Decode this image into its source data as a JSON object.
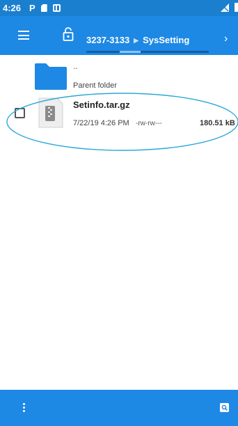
{
  "status_bar": {
    "time": "4:26",
    "p_icon": "P",
    "icons": [
      "p-icon",
      "sim-card-icon",
      "sd-card-icon",
      "no-signal-icon",
      "battery-icon"
    ]
  },
  "toolbar": {
    "menu_icon": "hamburger-menu-icon",
    "lock_icon": "lock-icon",
    "breadcrumb": [
      "3237-3133",
      "SysSetting"
    ],
    "breadcrumb_separator": "▶",
    "next_icon": "›"
  },
  "parent_folder": {
    "dots": "..",
    "label": "Parent folder"
  },
  "file": {
    "name": "Setinfo.tar.gz",
    "date": "7/22/19 4:26 PM",
    "permissions": "-rw-rw---",
    "size": "180.51 kB"
  },
  "bottom_bar": {
    "more_icon": "more-vert-icon",
    "search_icon": "search-icon"
  },
  "colors": {
    "status_bar": "#1b7fd0",
    "toolbar": "#1e88e5",
    "folder": "#1e88e5",
    "annotation": "#2aa8d8"
  }
}
